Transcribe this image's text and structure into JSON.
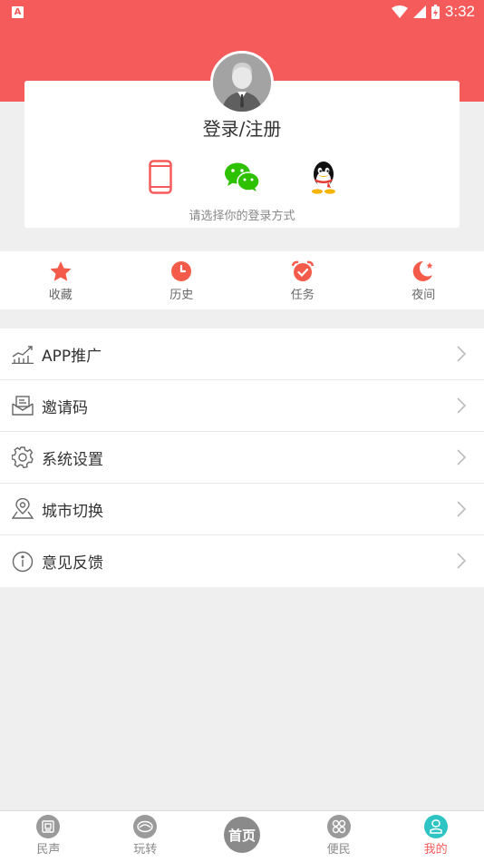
{
  "status_bar": {
    "app_badge": "A",
    "time": "3:32"
  },
  "login_card": {
    "title": "登录/注册",
    "hint": "请选择你的登录方式",
    "methods": [
      "phone-icon",
      "wechat-icon",
      "qq-icon"
    ]
  },
  "quick_actions": [
    {
      "label": "收藏",
      "icon": "star-icon"
    },
    {
      "label": "历史",
      "icon": "clock-icon"
    },
    {
      "label": "任务",
      "icon": "alarm-icon"
    },
    {
      "label": "夜间",
      "icon": "moon-icon"
    }
  ],
  "menu": [
    {
      "label": "APP推广",
      "icon": "chart-icon"
    },
    {
      "label": "邀请码",
      "icon": "envelope-icon"
    },
    {
      "label": "系统设置",
      "icon": "gear-icon"
    },
    {
      "label": "城市切换",
      "icon": "location-pin-icon"
    },
    {
      "label": "意见反馈",
      "icon": "info-icon"
    }
  ],
  "tabbar": [
    {
      "label": "民声"
    },
    {
      "label": "玩转"
    },
    {
      "label": "首页"
    },
    {
      "label": "便民"
    },
    {
      "label": "我的"
    }
  ],
  "colors": {
    "accent": "#f55b5b",
    "background": "#efefef",
    "wechat_green": "#2dc100"
  }
}
